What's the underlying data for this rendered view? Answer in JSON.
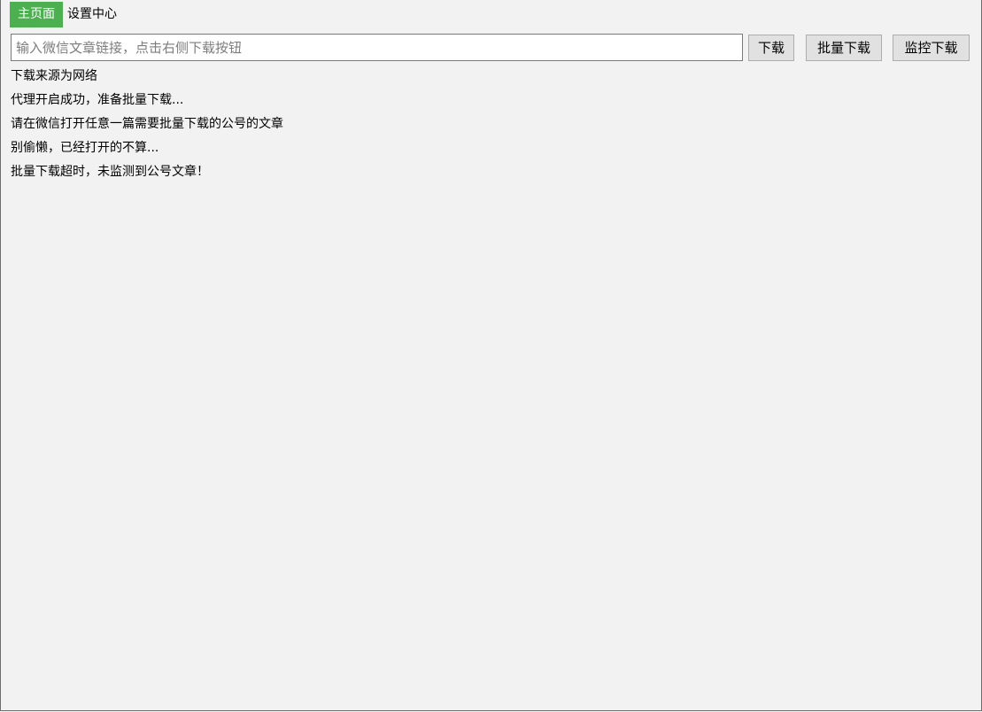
{
  "tabs": [
    {
      "label": "主页面",
      "active": true
    },
    {
      "label": "设置中心",
      "active": false
    }
  ],
  "toolbar": {
    "url_input": {
      "value": "",
      "placeholder": "输入微信文章链接，点击右侧下载按钮"
    },
    "download_label": "下载",
    "batch_download_label": "批量下载",
    "monitor_download_label": "监控下载"
  },
  "log": [
    "下载来源为网络",
    "代理开启成功，准备批量下载...",
    "请在微信打开任意一篇需要批量下载的公号的文章",
    "别偷懒，已经打开的不算...",
    "批量下载超时，未监测到公号文章！"
  ],
  "colors": {
    "active_tab_bg": "#4caf50",
    "window_bg": "#f2f2f2",
    "button_bg": "#e1e1e1"
  }
}
